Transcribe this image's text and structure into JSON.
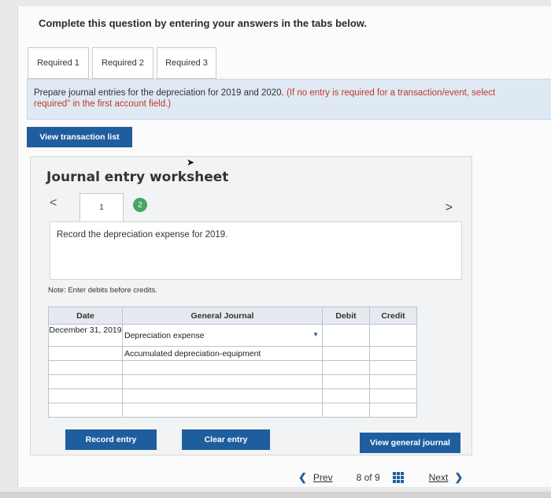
{
  "instruction": "Complete this question by entering your answers in the tabs below.",
  "tabs": [
    "Required 1",
    "Required 2",
    "Required 3"
  ],
  "prompt": {
    "main": "Prepare journal entries for the depreciation for 2019 and 2020.",
    "red": "(If no entry is required for a transaction/event, select",
    "red2": "required\" in the first account field.)"
  },
  "buttons": {
    "view_transaction": "View transaction list",
    "record_entry": "Record entry",
    "clear_entry": "Clear entry",
    "view_general_journal": "View general journal"
  },
  "worksheet": {
    "title": "Journal entry worksheet",
    "prev": "<",
    "next": ">",
    "page1": "1",
    "page2": "2",
    "record_text": "Record the depreciation expense for 2019.",
    "note": "Note: Enter debits before credits."
  },
  "table": {
    "headers": {
      "date": "Date",
      "account": "General Journal",
      "debit": "Debit",
      "credit": "Credit"
    },
    "rows": [
      {
        "date": "December 31, 2019",
        "account": "Depreciation expense",
        "debit": "",
        "credit": ""
      },
      {
        "date": "",
        "account": "Accumulated depreciation-equipment",
        "debit": "",
        "credit": ""
      },
      {
        "date": "",
        "account": "",
        "debit": "",
        "credit": ""
      },
      {
        "date": "",
        "account": "",
        "debit": "",
        "credit": ""
      },
      {
        "date": "",
        "account": "",
        "debit": "",
        "credit": ""
      },
      {
        "date": "",
        "account": "",
        "debit": "",
        "credit": ""
      }
    ]
  },
  "footer": {
    "prev": "Prev",
    "counter": "8 of 9",
    "next": "Next"
  },
  "colors": {
    "accent": "#1f5e9e",
    "prompt_bg": "#dfe9f3",
    "green": "#4aa564"
  }
}
